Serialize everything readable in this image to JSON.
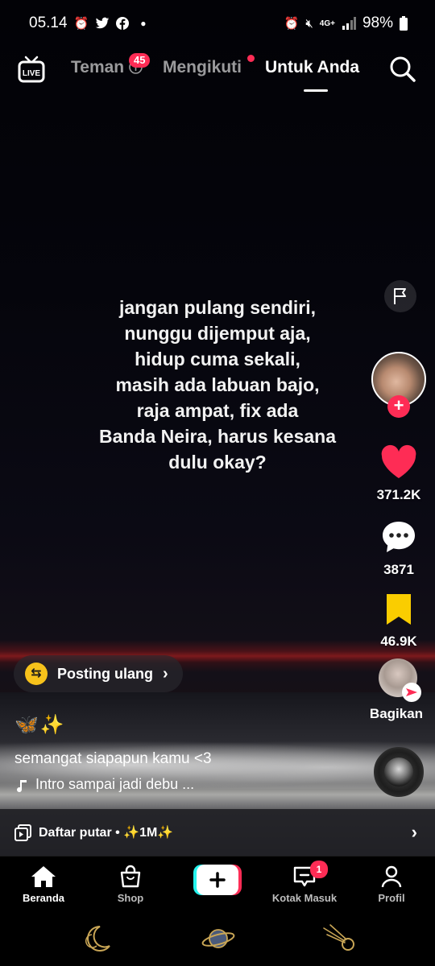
{
  "status_bar": {
    "time": "05.14",
    "battery": "98%",
    "network": "4G+"
  },
  "top_nav": {
    "live_label": "LIVE",
    "tabs": [
      {
        "label": "Teman",
        "badge": "45"
      },
      {
        "label": "Mengikuti",
        "has_dot": true
      },
      {
        "label": "Untuk Anda",
        "active": true
      }
    ]
  },
  "video": {
    "caption_lines": [
      "jangan pulang sendiri,",
      "nunggu dijemput aja,",
      "hidup cuma sekali,",
      "masih ada labuan bajo,",
      "raja ampat, fix ada",
      "Banda Neira, harus kesana",
      "dulu okay?"
    ]
  },
  "actions": {
    "likes": "371.2K",
    "comments": "3871",
    "saves": "46.9K",
    "share_label": "Bagikan"
  },
  "post": {
    "repost_label": "Posting ulang",
    "emoji_line": "🦋✨",
    "description": "semangat siapapun kamu <3",
    "music": "Intro sampai jadi debu ..."
  },
  "playlist": {
    "label": "Daftar putar • ✨1M✨"
  },
  "bottom_nav": {
    "items": [
      {
        "label": "Beranda",
        "active": true
      },
      {
        "label": "Shop"
      },
      {
        "label": "Kotak Masuk",
        "badge": "1"
      },
      {
        "label": "Profil"
      }
    ]
  },
  "colors": {
    "accent": "#fe2c55",
    "repost_yellow": "#f7c21b",
    "save_yellow": "#facd00"
  }
}
